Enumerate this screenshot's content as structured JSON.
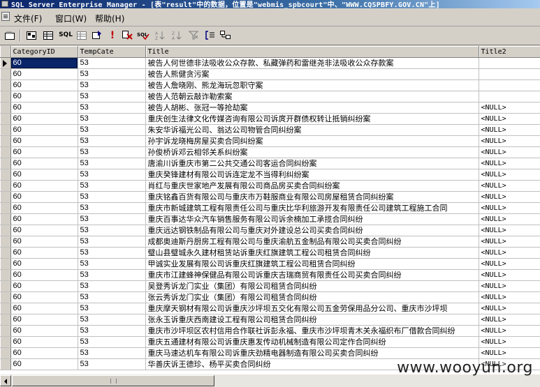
{
  "window": {
    "title": "SQL Server Enterprise Manager - [表\"result\"中的数据，位置是\"webmis_spbcourt\"中、\"WWW.CQSPBFY.GOV.CN\"上]"
  },
  "menu": {
    "items": [
      "文件(F)",
      "窗口(W)",
      "帮助(H)"
    ]
  },
  "toolbar": {
    "buttons": [
      {
        "name": "properties-icon",
        "glyph": "▣"
      },
      {
        "name": "show-diagram-pane-icon",
        "glyph": "▭"
      },
      {
        "name": "show-grid-pane-icon",
        "glyph": "▤"
      },
      {
        "name": "show-sql-pane-icon",
        "glyph": "SQL"
      },
      {
        "name": "show-results-pane-icon",
        "glyph": "▦"
      },
      {
        "name": "change-query-type-icon",
        "glyph": "⊡"
      },
      {
        "name": "run-icon",
        "glyph": "!"
      },
      {
        "name": "cancel-query-icon",
        "glyph": "✖"
      },
      {
        "name": "verify-sql-icon",
        "glyph": "✔"
      },
      {
        "name": "sort-ascending-icon",
        "glyph": "↓"
      },
      {
        "name": "sort-descending-icon",
        "glyph": "↑"
      },
      {
        "name": "remove-filter-icon",
        "glyph": "⊘"
      },
      {
        "name": "group-by-icon",
        "glyph": "≡"
      },
      {
        "name": "add-table-icon",
        "glyph": "⊞"
      }
    ]
  },
  "grid": {
    "columns": [
      "CategoryID",
      "TempCate",
      "Title",
      "Title2"
    ],
    "rows": [
      [
        "60",
        "53",
        "被告人何世德非法吸收公众存款、私藏弹药和雷继尧非法吸收公众存款案",
        ""
      ],
      [
        "60",
        "53",
        "被告人熊健贪污案",
        ""
      ],
      [
        "60",
        "53",
        "被告人詹晓刚、熊龙海玩忽职守案",
        ""
      ],
      [
        "60",
        "53",
        "被告人范朝云敲诈勒索案",
        ""
      ],
      [
        "60",
        "53",
        "被告人胡彬、张冠一等抢劫案",
        "<NULL>"
      ],
      [
        "60",
        "53",
        "重庆创生法律文化传媒咨询有限公司诉庹开群债权转让抵销纠纷案",
        "<NULL>"
      ],
      [
        "60",
        "53",
        "朱安华诉福光公司、翁达公司物管合同纠纷案",
        "<NULL>"
      ],
      [
        "60",
        "53",
        "孙宇诉龙晓梅房屋买卖合同纠纷案",
        "<NULL>"
      ],
      [
        "60",
        "53",
        "孙俊桥诉邓云相邻关系纠纷案",
        "<NULL>"
      ],
      [
        "60",
        "53",
        "唐渝川诉重庆市第二公共交通公司客运合同纠纷案",
        "<NULL>"
      ],
      [
        "60",
        "53",
        "重庆癸锋建材有限公司诉连定龙不当得利纠纷案",
        "<NULL>"
      ],
      [
        "60",
        "53",
        "肖红与重庆世家地产发展有限公司商品房买卖合同纠纷案",
        "<NULL>"
      ],
      [
        "60",
        "53",
        "重庆铭鑫百货有限公司与重庆市万鞋服商业有限公司房屋租赁合同纠纷案",
        "<NULL>"
      ],
      [
        "60",
        "53",
        "重庆市新城建筑工程有限责任公司与重庆比华利旅游开发有限责任公司建筑工程施工合同",
        "<NULL>"
      ],
      [
        "60",
        "53",
        "重庆百事达华众汽车销售服务有限公司诉余楠加工承揽合同纠纷",
        "<NULL>"
      ],
      [
        "60",
        "53",
        "重庆远达钢铁制品有限公司与重庆对外建设总公司买卖合同纠纷",
        "<NULL>"
      ],
      [
        "60",
        "53",
        "成都奥迪斯丹厨房工程有限公司与重庆渝航五金制品有限公司买卖合同纠纷",
        "<NULL>"
      ],
      [
        "60",
        "53",
        "璧山县璧城永久建材租赁站诉重庆红旗建筑工程公司租赁合同纠纷",
        "<NULL>"
      ],
      [
        "60",
        "53",
        "甲诚实业发展有限公司诉重庆红旗建筑工程公司租赁合同纠纷",
        "<NULL>"
      ],
      [
        "60",
        "53",
        "重庆市江建蜂神保健品有限公司诉重庆吉瑞商贸有限责任公司买卖合同纠纷",
        "<NULL>"
      ],
      [
        "60",
        "53",
        "吴登秀诉龙门实业（集团）有限公司租赁合同纠纷",
        "<NULL>"
      ],
      [
        "60",
        "53",
        "张云秀诉龙门实业（集团）有限公司租赁合同纠纷",
        "<NULL>"
      ],
      [
        "60",
        "53",
        "重庆摩天钢材有限公司诉重庆沙坪坝五交化有限公司五金劳保用品分公司、重庆市沙坪坝",
        "<NULL>"
      ],
      [
        "60",
        "53",
        "张永玉诉重庆西南建设工程有限公司租赁合同纠纷",
        "<NULL>"
      ],
      [
        "60",
        "53",
        "重庆市沙坪坝区农村信用合作联社诉彭永福、重庆市沙坪坝青木关永福织布厂借款合同纠纷",
        "<NULL>"
      ],
      [
        "60",
        "53",
        "重庆五通建材有限公司诉重庆惠发传动机械制造有限公司定作合同纠纷",
        "<NULL>"
      ],
      [
        "60",
        "53",
        "重庆马速达机车有限公司诉重庆劲精电器制造有限公司买卖合同纠纷",
        "<NULL>"
      ],
      [
        "60",
        "53",
        "华善庆诉王德珍、杨平买卖合同纠纷",
        "<NULL>"
      ]
    ]
  },
  "watermark": "www.wooyun.org"
}
